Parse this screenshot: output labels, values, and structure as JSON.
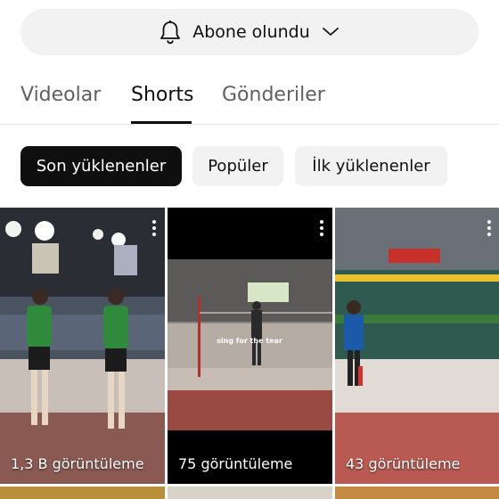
{
  "subscribe": {
    "label": "Abone olundu",
    "bell_icon": "bell-icon",
    "chevron_icon": "chevron-down-icon"
  },
  "tabs": [
    {
      "label": "Videolar"
    },
    {
      "label": "Shorts",
      "active": true
    },
    {
      "label": "Gönderiler"
    }
  ],
  "chips": [
    {
      "label": "Son yüklenenler",
      "active": true
    },
    {
      "label": "Popüler"
    },
    {
      "label": "İlk yüklenenler"
    }
  ],
  "shorts": [
    {
      "views": "1,3 B görüntüleme"
    },
    {
      "views": "75 görüntüleme",
      "overlay_text": "sing for the tear"
    },
    {
      "views": "43 görüntüleme"
    }
  ],
  "colors": {
    "text": "#0f0f0f",
    "muted": "#606060",
    "chip_bg": "#f2f2f2",
    "chip_active_bg": "#0f0f0f"
  }
}
